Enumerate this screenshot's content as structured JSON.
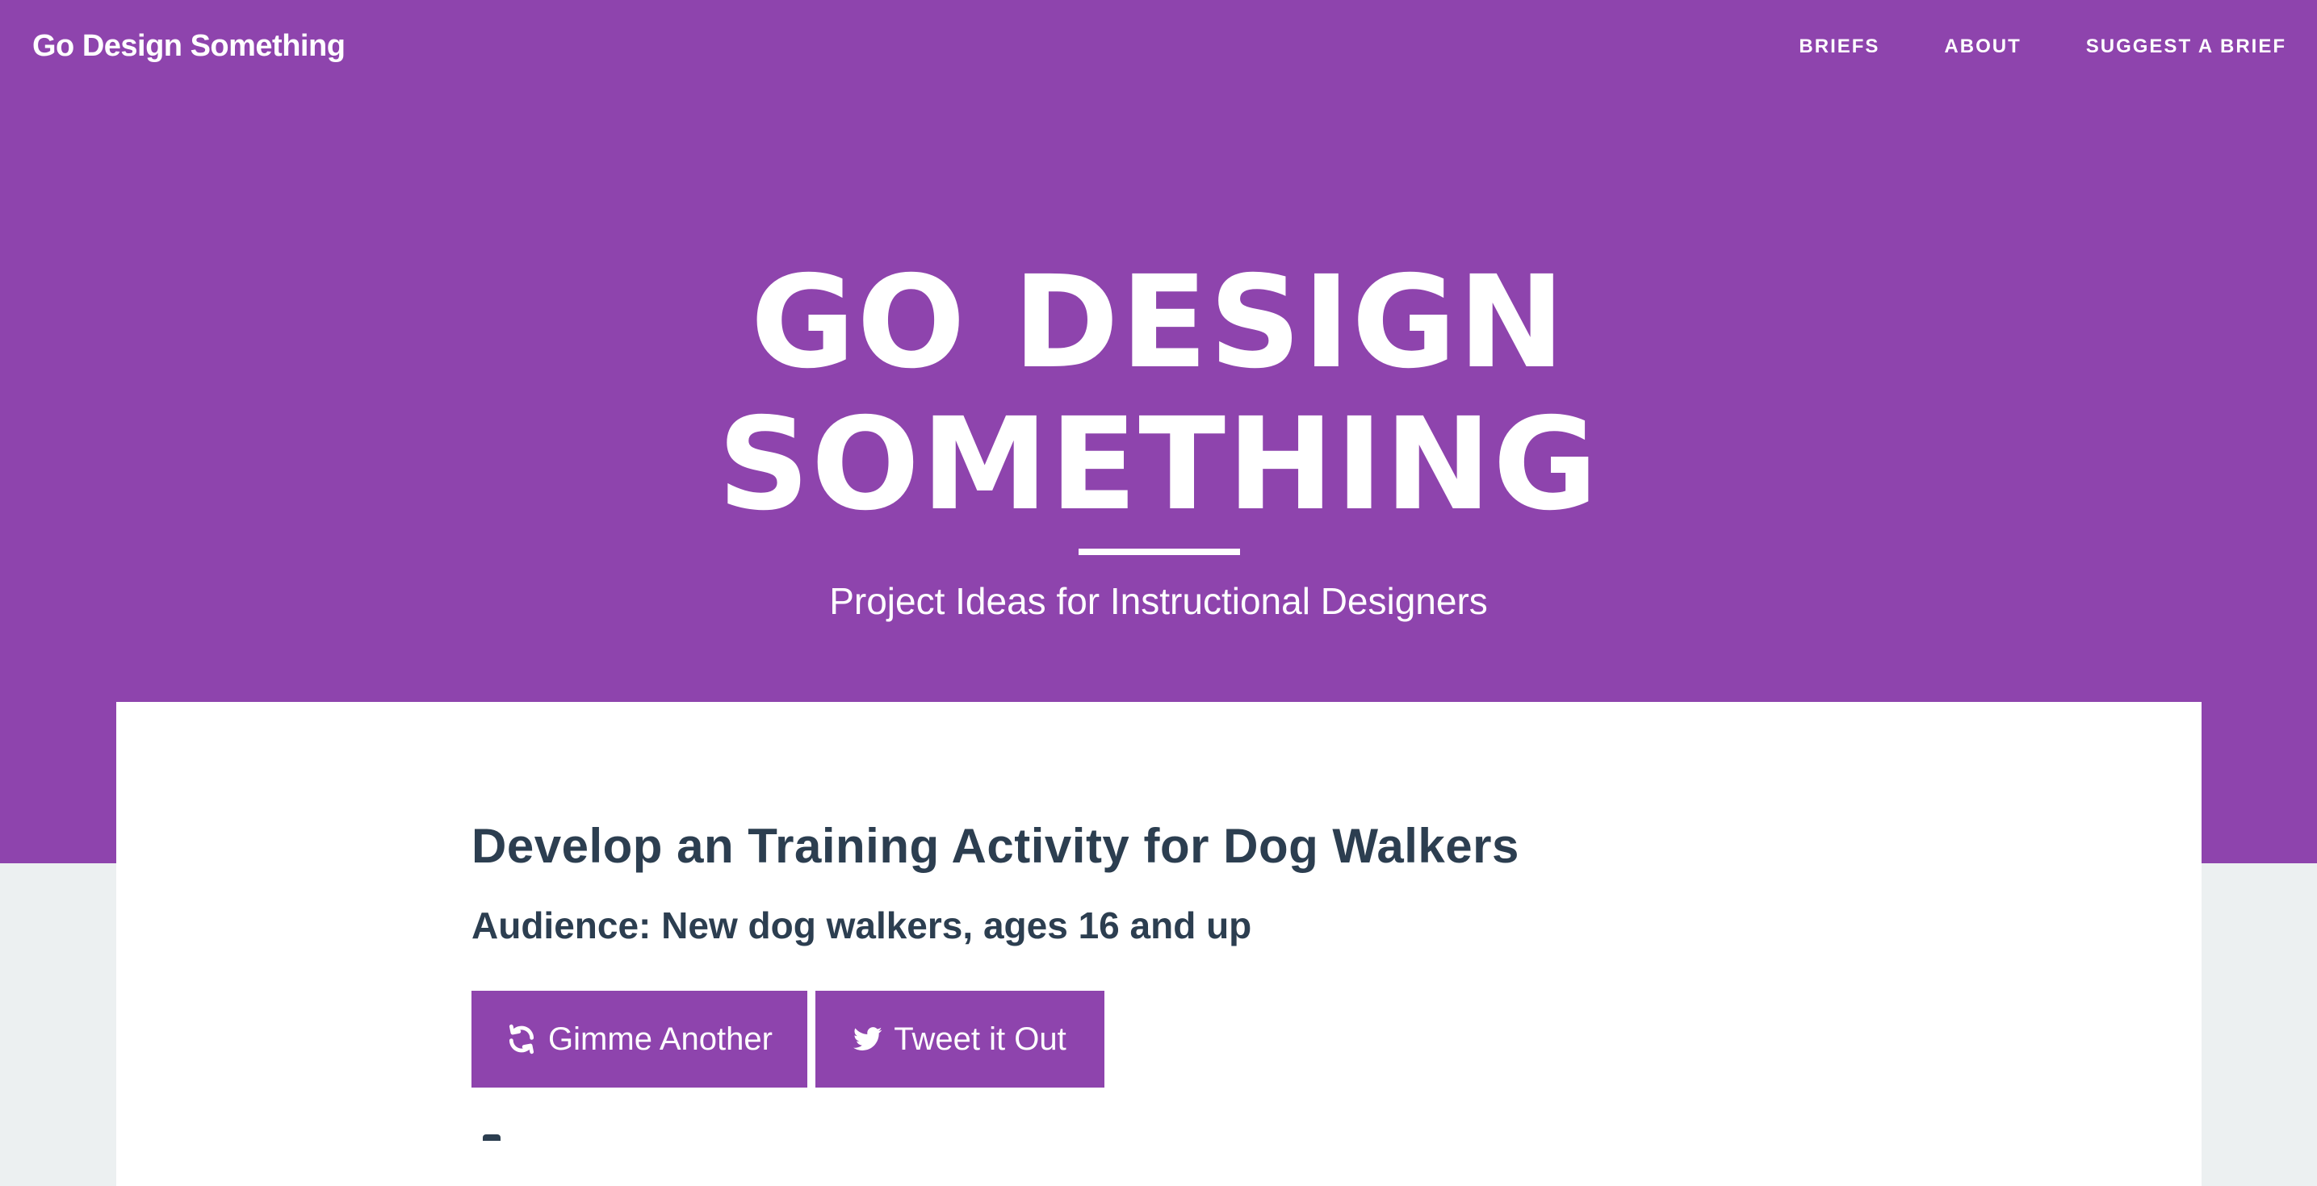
{
  "navbar": {
    "brand": "Go Design Something",
    "links": [
      "BRIEFS",
      "ABOUT",
      "SUGGEST A BRIEF"
    ]
  },
  "hero": {
    "title_line1": "GO DESIGN",
    "title_line2": "SOMETHING",
    "subtitle": "Project Ideas for Instructional Designers"
  },
  "brief": {
    "title": "Develop an Training Activity for Dog Walkers",
    "audience": "Audience: New dog walkers, ages 16 and up"
  },
  "buttons": {
    "another_label": "Gimme Another",
    "another_icon": "refresh-icon",
    "tweet_label": "Tweet it Out",
    "tweet_icon": "twitter-icon"
  },
  "colors": {
    "brand_purple": "#8e44ad",
    "text_dark": "#2c3e50",
    "page_bg": "#ecf0f1",
    "white": "#ffffff"
  }
}
